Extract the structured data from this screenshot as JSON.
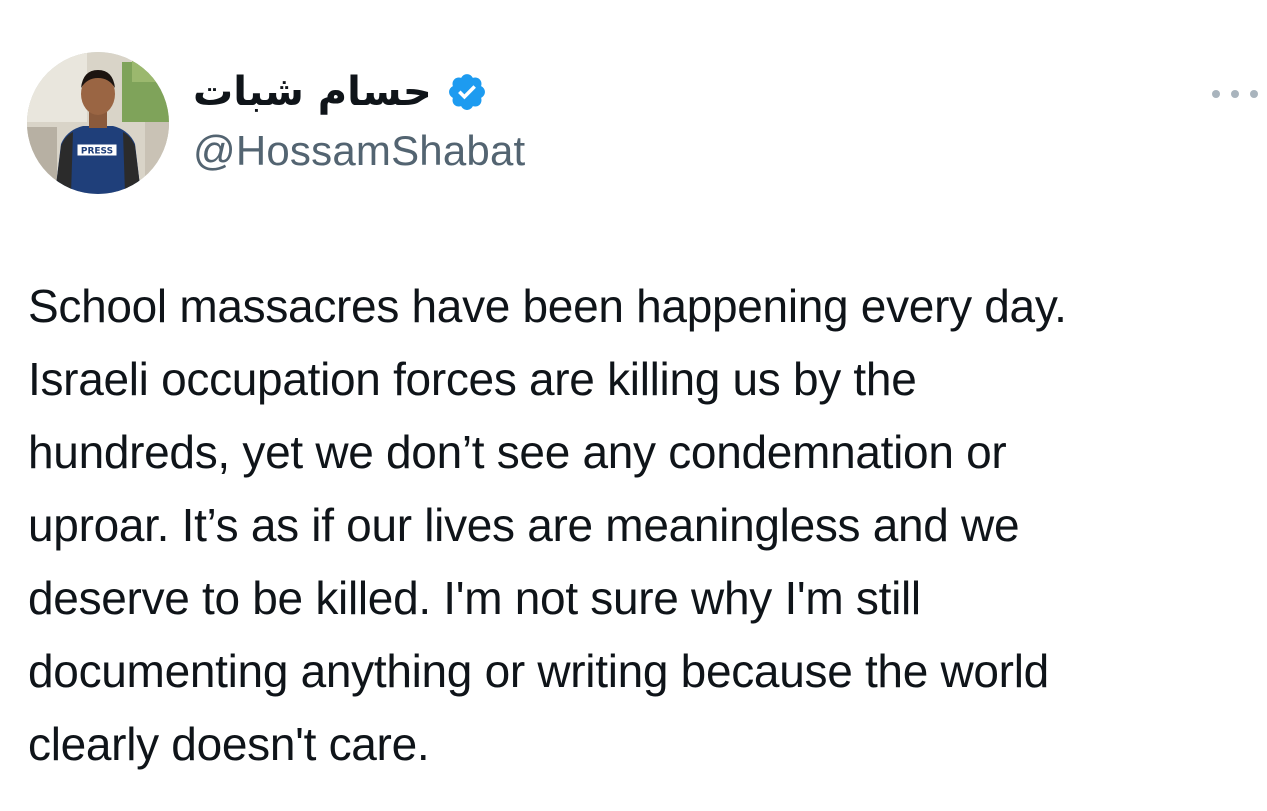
{
  "author": {
    "display_name": "حسام شبات",
    "handle": "@HossamShabat",
    "verified": true,
    "avatar_badge_text": "PRESS"
  },
  "tweet": {
    "lines": [
      "School massacres have been happening every day.",
      "Israeli occupation forces are killing us by the",
      "hundreds, yet we don’t see any condemnation or",
      "uproar. It’s as if our lives are meaningless and we",
      "deserve to be killed. I'm not sure why I'm still",
      "documenting anything or writing because the world",
      "clearly doesn't care."
    ]
  },
  "icons": {
    "verified": "verified-badge-icon",
    "more": "more-options-icon"
  },
  "colors": {
    "verified_blue": "#1d9bf0",
    "handle_gray": "#536471",
    "text": "#0f1419",
    "more_dots": "#a9b4bd"
  }
}
